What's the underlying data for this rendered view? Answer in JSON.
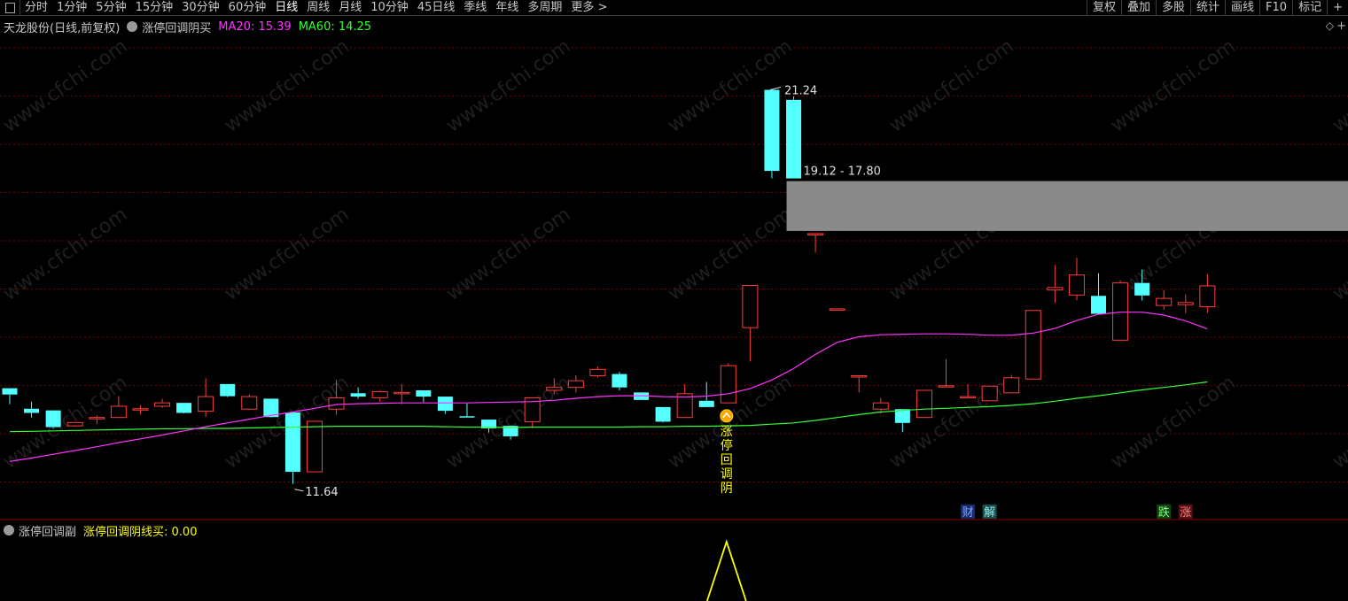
{
  "toolbar": {
    "periods": [
      {
        "label": "分时",
        "active": false
      },
      {
        "label": "1分钟",
        "active": false
      },
      {
        "label": "5分钟",
        "active": false
      },
      {
        "label": "15分钟",
        "active": false
      },
      {
        "label": "30分钟",
        "active": false
      },
      {
        "label": "60分钟",
        "active": false
      },
      {
        "label": "日线",
        "active": true
      },
      {
        "label": "周线",
        "active": false
      },
      {
        "label": "月线",
        "active": false
      },
      {
        "label": "10分钟",
        "active": false
      },
      {
        "label": "45日线",
        "active": false
      },
      {
        "label": "季线",
        "active": false
      },
      {
        "label": "年线",
        "active": false
      },
      {
        "label": "多周期",
        "active": false
      },
      {
        "label": "更多 >",
        "active": false
      }
    ],
    "tools": [
      "复权",
      "叠加",
      "多股",
      "统计",
      "画线",
      "F10",
      "标记",
      "+"
    ]
  },
  "info": {
    "symbol": "天龙股份(日线,前复权)",
    "indicator": "涨停回调阴买",
    "ma20": "MA20: 15.39",
    "ma60": "MA60: 14.25",
    "diamond": "◇",
    "plus": "+"
  },
  "sub": {
    "name": "涨停回调副",
    "value_label": "涨停回调阴线买: 0.00"
  },
  "colors": {
    "up": "#ff3c3c",
    "down": "#54ffff",
    "ma20": "#ff33ff",
    "ma60": "#33ff33",
    "grid": "#7a0000",
    "signal": "#ffff00",
    "background": "#000000"
  },
  "chart_data": {
    "type": "candlestick",
    "title": "",
    "y_range": [
      11.0,
      22.5
    ],
    "candles": [
      {
        "o": 14.1,
        "h": 14.1,
        "l": 13.72,
        "c": 13.95
      },
      {
        "o": 13.61,
        "h": 13.78,
        "l": 13.4,
        "c": 13.51
      },
      {
        "o": 13.57,
        "h": 13.57,
        "l": 13.13,
        "c": 13.17
      },
      {
        "o": 13.2,
        "h": 13.28,
        "l": 13.18,
        "c": 13.28
      },
      {
        "o": 13.4,
        "h": 13.45,
        "l": 13.24,
        "c": 13.4
      },
      {
        "o": 13.4,
        "h": 13.91,
        "l": 13.4,
        "c": 13.67
      },
      {
        "o": 13.58,
        "h": 13.7,
        "l": 13.47,
        "c": 13.61
      },
      {
        "o": 13.67,
        "h": 13.85,
        "l": 13.63,
        "c": 13.75
      },
      {
        "o": 13.75,
        "h": 13.75,
        "l": 13.5,
        "c": 13.51
      },
      {
        "o": 13.55,
        "h": 14.34,
        "l": 13.42,
        "c": 13.9
      },
      {
        "o": 14.2,
        "h": 14.2,
        "l": 13.89,
        "c": 13.91
      },
      {
        "o": 13.6,
        "h": 13.95,
        "l": 13.58,
        "c": 13.9
      },
      {
        "o": 13.85,
        "h": 13.85,
        "l": 13.4,
        "c": 13.41
      },
      {
        "o": 13.52,
        "h": 13.52,
        "l": 11.81,
        "c": 12.1
      },
      {
        "o": 12.1,
        "h": 13.31,
        "l": 12.1,
        "c": 13.31
      },
      {
        "o": 13.6,
        "h": 14.3,
        "l": 13.46,
        "c": 13.87
      },
      {
        "o": 13.98,
        "h": 14.12,
        "l": 13.85,
        "c": 13.9
      },
      {
        "o": 13.87,
        "h": 14.05,
        "l": 13.78,
        "c": 14.02
      },
      {
        "o": 14.0,
        "h": 14.2,
        "l": 13.72,
        "c": 14.0
      },
      {
        "o": 14.05,
        "h": 14.05,
        "l": 13.77,
        "c": 13.9
      },
      {
        "o": 13.9,
        "h": 13.9,
        "l": 13.49,
        "c": 13.56
      },
      {
        "o": 13.43,
        "h": 13.73,
        "l": 13.4,
        "c": 13.4
      },
      {
        "o": 13.35,
        "h": 13.35,
        "l": 13.04,
        "c": 13.14
      },
      {
        "o": 13.2,
        "h": 13.2,
        "l": 12.87,
        "c": 12.95
      },
      {
        "o": 13.3,
        "h": 13.87,
        "l": 13.14,
        "c": 13.87
      },
      {
        "o": 14.05,
        "h": 14.34,
        "l": 13.95,
        "c": 14.12
      },
      {
        "o": 14.12,
        "h": 14.41,
        "l": 14.0,
        "c": 14.28
      },
      {
        "o": 14.4,
        "h": 14.62,
        "l": 14.35,
        "c": 14.55
      },
      {
        "o": 14.44,
        "h": 14.49,
        "l": 14.05,
        "c": 14.12
      },
      {
        "o": 14.0,
        "h": 14.0,
        "l": 13.82,
        "c": 13.82
      },
      {
        "o": 13.65,
        "h": 13.65,
        "l": 13.28,
        "c": 13.3
      },
      {
        "o": 13.4,
        "h": 14.2,
        "l": 13.4,
        "c": 13.97
      },
      {
        "o": 13.8,
        "h": 14.25,
        "l": 13.75,
        "c": 13.65
      },
      {
        "o": 13.75,
        "h": 14.7,
        "l": 13.75,
        "c": 14.64
      },
      {
        "o": 15.55,
        "h": 16.56,
        "l": 14.74,
        "c": 16.56
      },
      {
        "o": 21.24,
        "h": 21.24,
        "l": 19.12,
        "c": 19.3
      },
      {
        "o": 21.0,
        "h": 21.08,
        "l": 19.12,
        "c": 19.12
      },
      {
        "o": 17.8,
        "h": 17.8,
        "l": 17.35,
        "c": 17.8
      },
      {
        "o": 16.0,
        "h": 16.0,
        "l": 16.0,
        "c": 16.0
      },
      {
        "o": 14.4,
        "h": 14.4,
        "l": 14.0,
        "c": 14.4
      },
      {
        "o": 13.6,
        "h": 13.86,
        "l": 13.5,
        "c": 13.75
      },
      {
        "o": 13.6,
        "h": 13.6,
        "l": 13.05,
        "c": 13.27
      },
      {
        "o": 13.4,
        "h": 14.05,
        "l": 13.4,
        "c": 14.05
      },
      {
        "o": 14.16,
        "h": 14.8,
        "l": 14.16,
        "c": 14.16
      },
      {
        "o": 13.9,
        "h": 14.2,
        "l": 13.86,
        "c": 13.9
      },
      {
        "o": 13.8,
        "h": 14.15,
        "l": 13.79,
        "c": 14.15
      },
      {
        "o": 13.99,
        "h": 14.42,
        "l": 13.99,
        "c": 14.35
      },
      {
        "o": 14.32,
        "h": 15.96,
        "l": 14.32,
        "c": 15.96
      },
      {
        "o": 16.45,
        "h": 17.05,
        "l": 16.14,
        "c": 16.51
      },
      {
        "o": 16.33,
        "h": 17.22,
        "l": 16.21,
        "c": 16.81
      },
      {
        "o": 16.31,
        "h": 16.85,
        "l": 15.88,
        "c": 15.88
      },
      {
        "o": 15.25,
        "h": 16.68,
        "l": 15.25,
        "c": 16.62
      },
      {
        "o": 16.62,
        "h": 16.94,
        "l": 16.2,
        "c": 16.32
      },
      {
        "o": 16.08,
        "h": 16.45,
        "l": 15.98,
        "c": 16.25
      },
      {
        "o": 16.1,
        "h": 16.35,
        "l": 15.9,
        "c": 16.15
      },
      {
        "o": 16.05,
        "h": 16.83,
        "l": 15.9,
        "c": 16.55
      }
    ],
    "ma20": [
      12.35,
      12.43,
      12.52,
      12.61,
      12.7,
      12.8,
      12.89,
      12.98,
      13.08,
      13.18,
      13.27,
      13.36,
      13.45,
      13.53,
      13.62,
      13.71,
      13.73,
      13.74,
      13.75,
      13.75,
      13.75,
      13.75,
      13.76,
      13.77,
      13.78,
      13.81,
      13.86,
      13.9,
      13.92,
      13.92,
      13.9,
      13.89,
      13.91,
      13.97,
      14.09,
      14.3,
      14.57,
      14.91,
      15.2,
      15.33,
      15.38,
      15.39,
      15.4,
      15.4,
      15.39,
      15.37,
      15.37,
      15.42,
      15.53,
      15.72,
      15.87,
      15.92,
      15.92,
      15.85,
      15.71,
      15.52
    ],
    "ma60": [
      13.06,
      13.07,
      13.08,
      13.09,
      13.1,
      13.11,
      13.12,
      13.13,
      13.13,
      13.14,
      13.14,
      13.15,
      13.16,
      13.17,
      13.18,
      13.19,
      13.19,
      13.19,
      13.19,
      13.19,
      13.18,
      13.17,
      13.17,
      13.16,
      13.17,
      13.17,
      13.17,
      13.17,
      13.17,
      13.18,
      13.18,
      13.19,
      13.19,
      13.2,
      13.21,
      13.24,
      13.27,
      13.33,
      13.4,
      13.47,
      13.53,
      13.57,
      13.6,
      13.62,
      13.64,
      13.66,
      13.69,
      13.73,
      13.79,
      13.86,
      13.92,
      13.99,
      14.06,
      14.12,
      14.18,
      14.25
    ],
    "labels": {
      "high": "21.24",
      "low": "11.64",
      "range": "19.12 - 17.80",
      "signal": "涨停回调阴",
      "tags": [
        "财",
        "解",
        "跌",
        "涨"
      ]
    },
    "sub": {
      "signal_value": 0.0,
      "signal_index": 33
    }
  }
}
